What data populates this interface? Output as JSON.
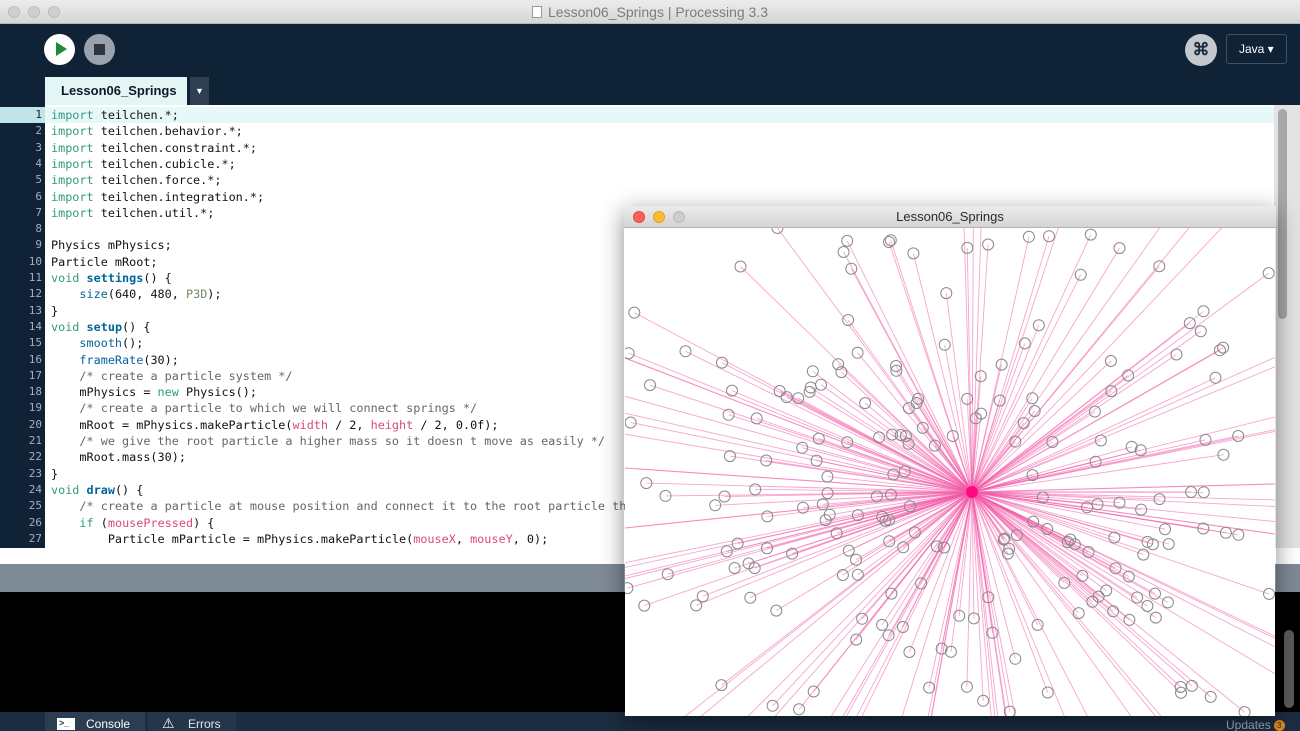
{
  "window": {
    "title": "Lesson06_Springs | Processing 3.3"
  },
  "toolbar": {
    "run_label": "Run",
    "stop_label": "Stop",
    "debug_glyph": "⌘",
    "mode": "Java ▾"
  },
  "tabs": {
    "active": "Lesson06_Springs",
    "menu_glyph": "▼"
  },
  "code": {
    "lines": [
      {
        "n": "1",
        "html": "<span class='kw'>import</span> teilchen.*;"
      },
      {
        "n": "2",
        "html": "<span class='kw'>import</span> teilchen.behavior.*;"
      },
      {
        "n": "3",
        "html": "<span class='kw'>import</span> teilchen.constraint.*;"
      },
      {
        "n": "4",
        "html": "<span class='kw'>import</span> teilchen.cubicle.*;"
      },
      {
        "n": "5",
        "html": "<span class='kw'>import</span> teilchen.force.*;"
      },
      {
        "n": "6",
        "html": "<span class='kw'>import</span> teilchen.integration.*;"
      },
      {
        "n": "7",
        "html": "<span class='kw'>import</span> teilchen.util.*;"
      },
      {
        "n": "8",
        "html": ""
      },
      {
        "n": "9",
        "html": "Physics mPhysics;"
      },
      {
        "n": "10",
        "html": "Particle mRoot;"
      },
      {
        "n": "11",
        "html": "<span class='kw'>void</span> <span class='fnb'>settings</span>() {"
      },
      {
        "n": "12",
        "html": "    <span class='fn'>size</span>(640, 480, <span class='cn'>P3D</span>);"
      },
      {
        "n": "13",
        "html": "}"
      },
      {
        "n": "14",
        "html": "<span class='kw'>void</span> <span class='fnb'>setup</span>() {"
      },
      {
        "n": "15",
        "html": "    <span class='fn'>smooth</span>();"
      },
      {
        "n": "16",
        "html": "    <span class='fn'>frameRate</span>(30);"
      },
      {
        "n": "17",
        "html": "    <span class='cm'>/* create a particle system */</span>"
      },
      {
        "n": "18",
        "html": "    mPhysics = <span class='kw'>new</span> Physics();"
      },
      {
        "n": "19",
        "html": "    <span class='cm'>/* create a particle to which we will connect springs */</span>"
      },
      {
        "n": "20",
        "html": "    mRoot = mPhysics.makeParticle(<span class='vr'>width</span> / 2, <span class='vr'>height</span> / 2, 0.0f);"
      },
      {
        "n": "21",
        "html": "    <span class='cm'>/* we give the root particle a higher mass so it doesn t move as easily */</span>"
      },
      {
        "n": "22",
        "html": "    mRoot.mass(30);"
      },
      {
        "n": "23",
        "html": "}"
      },
      {
        "n": "24",
        "html": "<span class='kw'>void</span> <span class='fnb'>draw</span>() {"
      },
      {
        "n": "25",
        "html": "    <span class='cm'>/* create a particle at mouse position and connect it to the root particle th</span>"
      },
      {
        "n": "26",
        "html": "    <span class='kw'>if</span> (<span class='vr'>mousePressed</span>) {"
      },
      {
        "n": "27",
        "html": "        Particle mParticle = mPhysics.makeParticle(<span class='vr'>mouseX</span>, <span class='vr'>mouseY</span>, 0);"
      }
    ]
  },
  "console": {
    "console_label": "Console",
    "errors_label": "Errors",
    "updates_label": "Updates",
    "updates_count": "3"
  },
  "sketch_window": {
    "title": "Lesson06_Springs",
    "root_color": "#ff0a84",
    "spring_color": "#f25aa8",
    "particle_stroke": "#8a8a8a",
    "particle_count": 260
  }
}
